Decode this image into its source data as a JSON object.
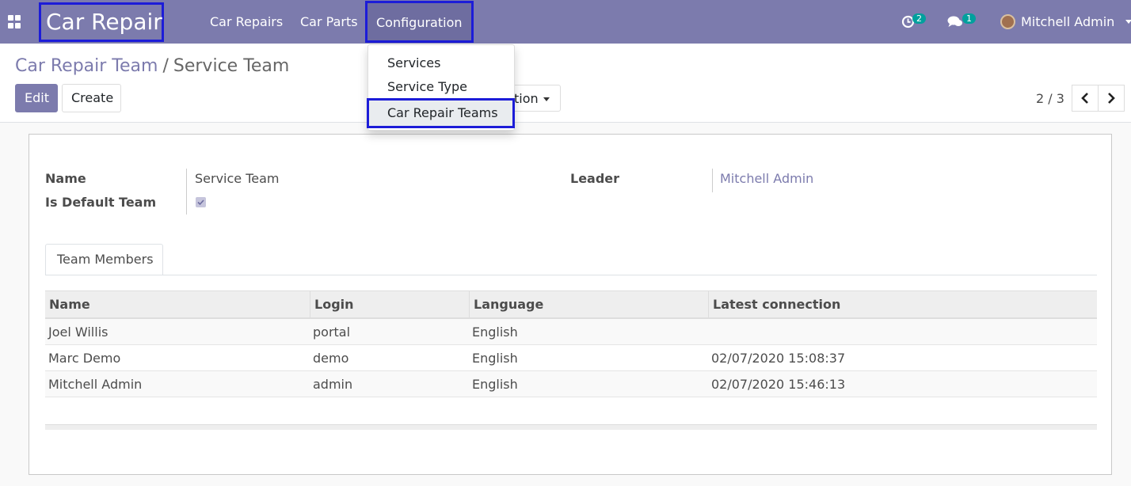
{
  "navbar": {
    "brand": "Car Repair",
    "menu": [
      "Car Repairs",
      "Car Parts",
      "Configuration"
    ],
    "activity_count": "2",
    "messages_count": "1",
    "user_name": "Mitchell Admin"
  },
  "control_panel": {
    "breadcrumb_parent": "Car Repair Team",
    "breadcrumb_separator": "/",
    "breadcrumb_current": "Service Team",
    "edit_label": "Edit",
    "create_label": "Create",
    "action_label_visible": "tion",
    "pager_value": "2 / 3"
  },
  "dropdown": {
    "items": [
      "Services",
      "Service Type",
      "Car Repair Teams"
    ]
  },
  "form": {
    "name_label": "Name",
    "name_value": "Service Team",
    "default_label": "Is Default Team",
    "default_checked": true,
    "leader_label": "Leader",
    "leader_value": "Mitchell Admin"
  },
  "tabs": [
    "Team Members"
  ],
  "table": {
    "columns": [
      "Name",
      "Login",
      "Language",
      "Latest connection"
    ],
    "rows": [
      [
        "Joel Willis",
        "portal",
        "English",
        ""
      ],
      [
        "Marc Demo",
        "demo",
        "English",
        "02/07/2020 15:08:37"
      ],
      [
        "Mitchell Admin",
        "admin",
        "English",
        "02/07/2020 15:46:13"
      ]
    ]
  },
  "colors": {
    "primary": "#7c7bad",
    "highlight_border": "#1c1cd8",
    "badge": "#00a09d"
  }
}
